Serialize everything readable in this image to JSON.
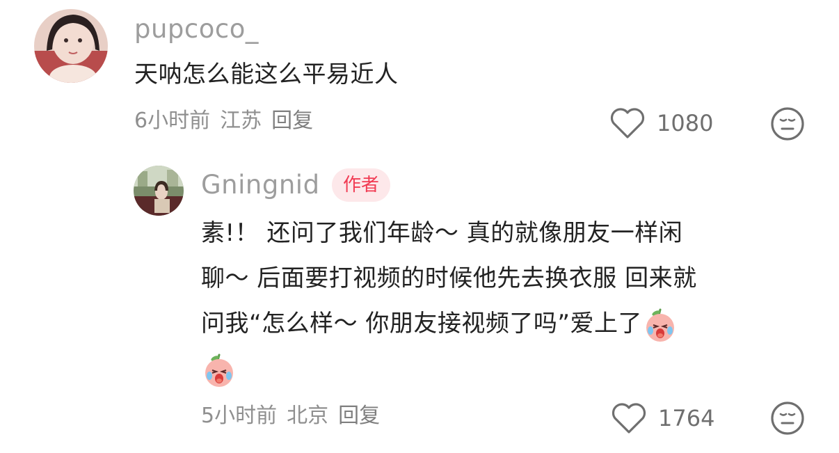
{
  "comment": {
    "username": "pupcoco_",
    "text": "天呐怎么能这么平易近人",
    "time": "6小时前",
    "location": "江苏",
    "reply_label": "回复",
    "like_count": "1080",
    "like_icon": "heart-outline",
    "dislike_icon": "meh-face"
  },
  "reply": {
    "username": "Gningnid",
    "author_badge": "作者",
    "lines": [
      "素!！ 还问了我们年龄～ 真的就像朋友一样闲",
      "聊～ 后面要打视频的时候他先去换衣服 回来就",
      "问我“怎么样～ 你朋友接视频了吗”爱上了"
    ],
    "emoji": "crying-peach-sticker",
    "time": "5小时前",
    "location": "北京",
    "reply_label": "回复",
    "like_count": "1764",
    "like_icon": "heart-outline",
    "dislike_icon": "meh-face"
  },
  "colors": {
    "username": "#9d9d9d",
    "text": "#222222",
    "meta": "#8f8f8f",
    "badge_bg": "#fde8ea",
    "badge_text": "#f13b53"
  }
}
